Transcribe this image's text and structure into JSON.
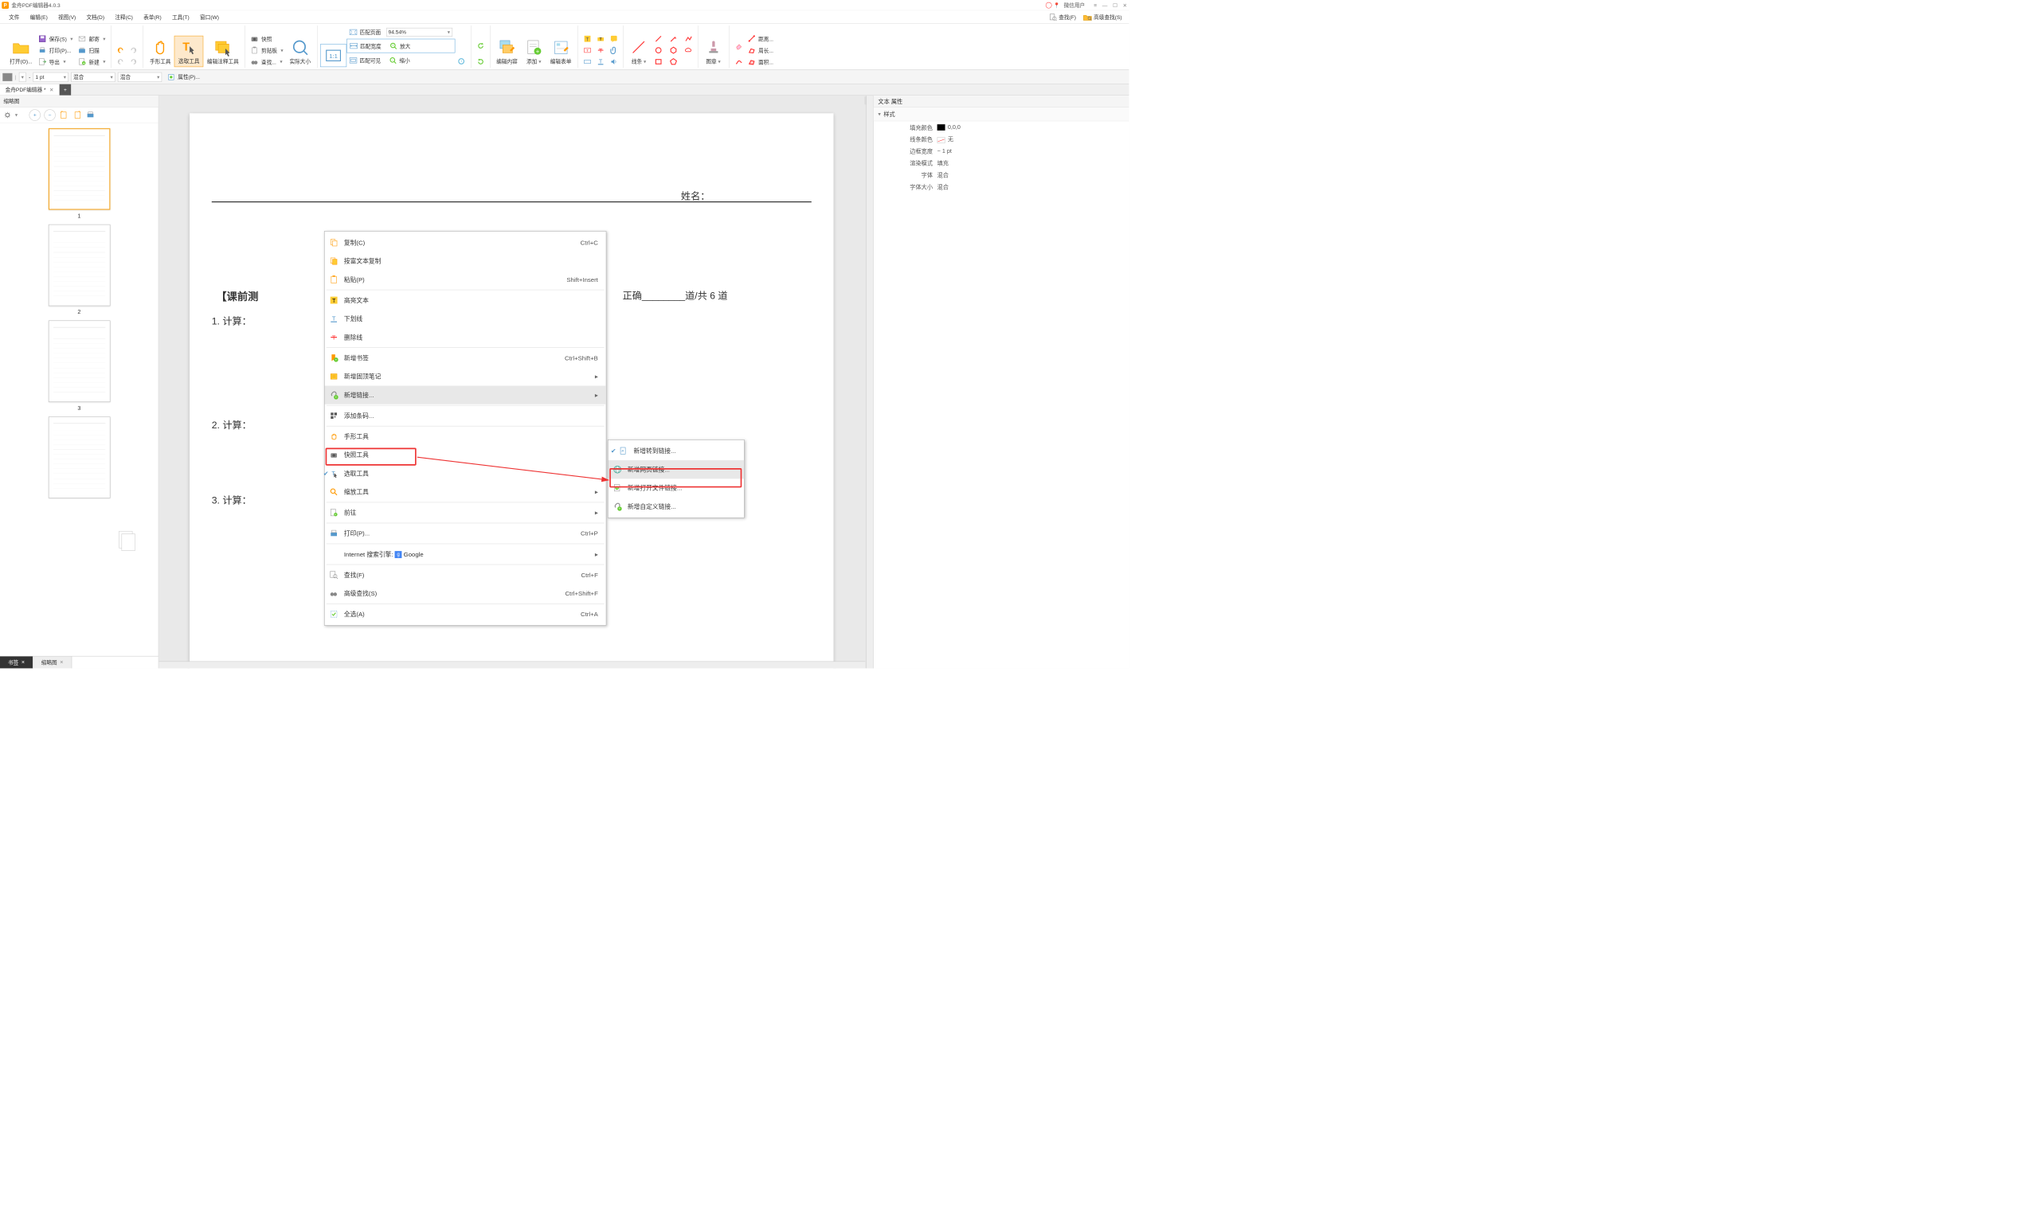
{
  "app": {
    "title": "金舟PDF编辑器4.0.3",
    "logo_letter": "P"
  },
  "titlebar": {
    "user_label": "微信用户",
    "pin_glyph": "📍"
  },
  "menubar": {
    "items": [
      "文件",
      "编辑(E)",
      "视图(V)",
      "文档(D)",
      "注释(C)",
      "表单(R)",
      "工具(T)",
      "窗口(W)"
    ],
    "find_label": "查找(F)",
    "advfind_label": "高级查找(S)"
  },
  "ribbon": {
    "open": "打开(O)...",
    "save": "保存(S)",
    "print": "打印(P)...",
    "export": "导出",
    "mail": "邮寄",
    "scan": "扫描",
    "new": "新建",
    "hand": "手形工具",
    "select": "选取工具",
    "anno": "编辑注释工具",
    "snapshot": "快照",
    "clipboard": "剪贴板",
    "find": "查找...",
    "actual": "实际大小",
    "onetoone": "1:1",
    "fitpage": "匹配页面",
    "fitwidth": "匹配宽度",
    "fitvisible": "匹配可见",
    "zoom": "94.54%",
    "zoomin": "放大",
    "zoomout": "缩小",
    "editcontent": "编辑内容",
    "add": "添加",
    "editform": "编辑表单",
    "lines": "线条",
    "stamp": "图章",
    "distance": "距离...",
    "perimeter": "周长...",
    "area": "面积..."
  },
  "propbar": {
    "width": "1 pt",
    "blend1": "混合",
    "blend2": "混合",
    "props": "属性(P)..."
  },
  "tabs": {
    "doc": "金舟PDF编辑器 *"
  },
  "thumbs": {
    "title": "缩略图",
    "pages": [
      "1",
      "2",
      "3"
    ],
    "btm_bookmark": "书签",
    "btm_thumbs": "缩略图"
  },
  "page": {
    "name_label": "姓名：",
    "pretest": "【课前测",
    "score_text": "正确________道/共 6 道",
    "q1": "1.  计算：",
    "q2": "2.  计算：",
    "q3": "3.  计算："
  },
  "rprops": {
    "title": "文本 属性",
    "style_sect": "样式",
    "fill_k": "填充颜色",
    "fill_v": "0,0,0",
    "stroke_k": "线条颜色",
    "stroke_v": "无",
    "bw_k": "边框宽度",
    "bw_v": "1 pt",
    "render_k": "渲染模式",
    "render_v": "填充",
    "font_k": "字体",
    "font_v": "混合",
    "size_k": "字体大小",
    "size_v": "混合"
  },
  "ctx": {
    "copy": "复制(C)",
    "copy_sc": "Ctrl+C",
    "copyrich": "按富文本复制",
    "paste": "粘贴(P)",
    "paste_sc": "Shift+Insert",
    "highlight": "高亮文本",
    "underline": "下划线",
    "strike": "删除线",
    "newbm": "新增书签",
    "newbm_sc": "Ctrl+Shift+B",
    "pinnote": "新增固顶笔记",
    "newlink": "新增链接...",
    "barcode": "添加条码...",
    "hand": "手形工具",
    "snap": "快照工具",
    "select": "选取工具",
    "zoom": "缩放工具",
    "goto": "前往",
    "print": "打印(P)...",
    "print_sc": "Ctrl+P",
    "search_engine": "Internet 搜索引擎:",
    "google": "Google",
    "find": "查找(F)",
    "find_sc": "Ctrl+F",
    "advfind": "高级查找(S)",
    "advfind_sc": "Ctrl+Shift+F",
    "selectall": "全选(A)",
    "selectall_sc": "Ctrl+A"
  },
  "submenu": {
    "gotolink": "新增转到链接...",
    "weblink": "新增网页链接...",
    "openfile": "新增打开文件链接...",
    "custom": "新增自定义链接..."
  }
}
